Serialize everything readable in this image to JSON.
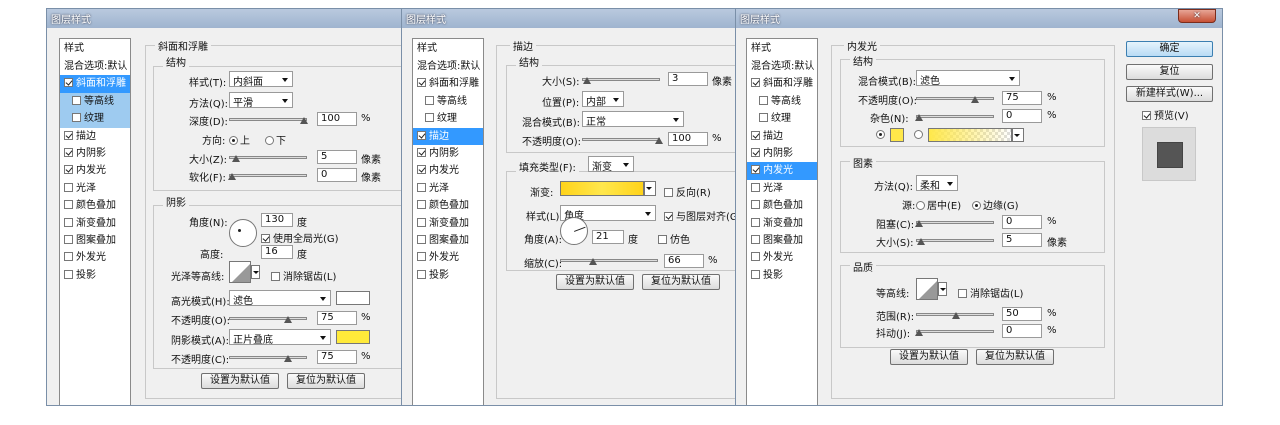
{
  "title": "图层样式",
  "styles_header": "样式",
  "blend_default": "混合选项:默认",
  "sidebar": [
    "斜面和浮雕",
    "等高线",
    "纹理",
    "描边",
    "内阴影",
    "内发光",
    "光泽",
    "颜色叠加",
    "渐变叠加",
    "图案叠加",
    "外发光",
    "投影"
  ],
  "w1": {
    "bevel_group": "斜面和浮雕",
    "structure": "结构",
    "style_label": "样式(T):",
    "style_value": "内斜面",
    "method_label": "方法(Q):",
    "method_value": "平滑",
    "depth_label": "深度(D):",
    "depth_value": "100",
    "depth_unit": "%",
    "direction_label": "方向:",
    "dir_up": "上",
    "dir_down": "下",
    "size_label": "大小(Z):",
    "size_value": "5",
    "size_unit": "像素",
    "soften_label": "软化(F):",
    "soften_value": "0",
    "soften_unit": "像素",
    "shading": "阴影",
    "angle_label": "角度(N):",
    "angle_value": "130",
    "angle_unit": "度",
    "global_light": "使用全局光(G)",
    "altitude_label": "高度:",
    "altitude_value": "16",
    "altitude_unit": "度",
    "gloss_label": "光泽等高线:",
    "antialias": "消除锯齿(L)",
    "hl_mode_label": "高光模式(H):",
    "hl_mode_value": "滤色",
    "hl_color": "#ffffff",
    "hl_op_label": "不透明度(O):",
    "hl_op_value": "75",
    "hl_op_unit": "%",
    "sh_mode_label": "阴影模式(A):",
    "sh_mode_value": "正片叠底",
    "sh_color": "#ffea3a",
    "sh_op_label": "不透明度(C):",
    "sh_op_value": "75",
    "sh_op_unit": "%",
    "btn_default": "设置为默认值",
    "btn_reset": "复位为默认值"
  },
  "w2": {
    "stroke_group": "描边",
    "structure": "结构",
    "size_label": "大小(S):",
    "size_value": "3",
    "size_unit": "像素",
    "pos_label": "位置(P):",
    "pos_value": "内部",
    "blend_label": "混合模式(B):",
    "blend_value": "正常",
    "op_label": "不透明度(O):",
    "op_value": "100",
    "op_unit": "%",
    "fill_label": "填充类型(F):",
    "fill_value": "渐变",
    "grad_label": "渐变:",
    "reverse": "反向(R)",
    "style_label": "样式(L):",
    "style_value": "角度",
    "align": "与图层对齐(G)",
    "angle_label": "角度(A):",
    "angle_value": "21",
    "angle_unit": "度",
    "dither": "仿色",
    "scale_label": "缩放(C):",
    "scale_value": "66",
    "scale_unit": "%",
    "btn_default": "设置为默认值",
    "btn_reset": "复位为默认值"
  },
  "w3": {
    "glow_group": "内发光",
    "structure": "结构",
    "blend_label": "混合模式(B):",
    "blend_value": "滤色",
    "op_label": "不透明度(O):",
    "op_value": "75",
    "op_unit": "%",
    "noise_label": "杂色(N):",
    "noise_value": "0",
    "noise_unit": "%",
    "elements": "图素",
    "technique_label": "方法(Q):",
    "technique_value": "柔和",
    "source_label": "源:",
    "source_center": "居中(E)",
    "source_edge": "边缘(G)",
    "choke_label": "阻塞(C):",
    "choke_value": "0",
    "choke_unit": "%",
    "size_label": "大小(S):",
    "size_value": "5",
    "size_unit": "像素",
    "quality": "品质",
    "contour_label": "等高线:",
    "antialias": "消除锯齿(L)",
    "range_label": "范围(R):",
    "range_value": "50",
    "range_unit": "%",
    "jitter_label": "抖动(J):",
    "jitter_value": "0",
    "jitter_unit": "%",
    "btn_default": "设置为默认值",
    "btn_reset": "复位为默认值",
    "ok": "确定",
    "reset": "复位",
    "new_style": "新建样式(W)...",
    "preview": "预览(V)",
    "glow_color": "#ffe84a"
  }
}
